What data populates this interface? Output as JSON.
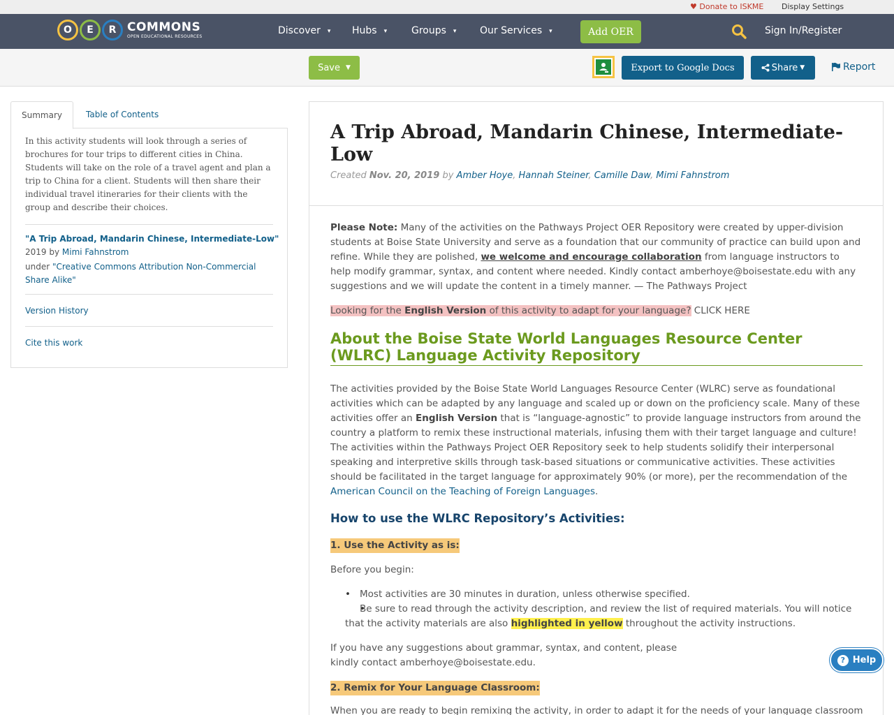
{
  "utility_bar": {
    "donate_label": "Donate to ISKME",
    "display_settings_label": "Display Settings"
  },
  "logo": {
    "letters": [
      "O",
      "E",
      "R"
    ],
    "main": "COMMONS",
    "sub": "OPEN EDUCATIONAL RESOURCES"
  },
  "nav": {
    "items": [
      {
        "label": "Discover"
      },
      {
        "label": "Hubs"
      },
      {
        "label": "Groups"
      },
      {
        "label": "Our Services"
      }
    ],
    "add_oer_label": "Add OER",
    "signin_label": "Sign In/Register"
  },
  "actions": {
    "save_label": "Save",
    "export_label": "Export to Google Docs",
    "share_label": "Share",
    "report_label": "Report"
  },
  "sidebar": {
    "tabs": [
      {
        "label": "Summary",
        "active": true
      },
      {
        "label": "Table of Contents",
        "active": false
      }
    ],
    "summary": "In this activity students will look through a series of brochures for tour trips to different cities in China. Students will take on the role of a travel agent and plan a trip to China for a client. Students will then share their individual travel itineraries for their clients with the group and describe their choices.",
    "license_title": "\"A Trip Abroad, Mandarin Chinese, Intermediate-Low\"",
    "license_year_by": "2019 by",
    "license_author": "Mimi Fahnstrom",
    "license_under": "under",
    "license_name": "\"Creative Commons Attribution Non-Commercial Share Alike\"",
    "version_history_label": "Version History",
    "cite_label": "Cite this work"
  },
  "resource": {
    "title": "A Trip Abroad, Mandarin Chinese, Intermediate-Low",
    "created_prefix": "Created",
    "created_date": "Nov. 20, 2019",
    "by": "by",
    "authors": [
      "Amber Hoye",
      "Hannah Steiner",
      "Camille Daw",
      "Mimi Fahnstrom"
    ],
    "note_label": "Please Note:",
    "note_text_1": "Many of the activities on the Pathways Project OER Repository were created by upper-division students at Boise State University and serve as a foundation that our community of practice can build upon and refine. While they are polished,",
    "note_collab": "we welcome and encourage collaboration",
    "note_text_2": "from language instructors to help modify grammar, syntax, and content where needed. Kindly contact amberhoye@boisestate.edu with any suggestions and we will update the content in a timely manner.  — The Pathways Project",
    "english_pre": "Looking for the",
    "english_bold": "English Version",
    "english_post": "of this activity to adapt for your language?",
    "click_here": "CLICK HERE",
    "about_heading": "About the Boise State World Languages Resource Center (WLRC) Language Activity Repository",
    "about_p1": "The activities provided by the Boise State World Languages Resource Center (WLRC) serve as foundational activities which can be adapted by any language and scaled up or down on the proficiency scale. Many of these activities offer an",
    "about_bold": "English Version",
    "about_p2": "that is “language-agnostic” to provide language instructors from around the country a platform to remix these instructional materials, infusing them with their target language and culture! The activities within the Pathways Project OER Repository seek to help students solidify their interpersonal speaking and interpretive skills through task-based situations or communicative activities. These activities should be facilitated in the target language for approximately 90% (or more), per the recommendation of the",
    "actfl_link": "American Council on the Teaching of Foreign Languages",
    "how_heading": "How to use the WLRC Repository’s Activities:",
    "step1": "1. Use the Activity as is:",
    "before_begin": "Before you begin:",
    "bullet1": "Most activities are 30 minutes in duration, unless otherwise specified.",
    "bullet2_pre": "Be sure to read through the activity description, and review the list of required materials. You will notice that the activity materials are also",
    "bullet2_hl": "highlighted in yellow",
    "bullet2_post": "throughout the activity instructions.",
    "suggestions": "If you have any suggestions about grammar, syntax, and content, please kindly contact amberhoye@boisestate.edu.",
    "step2": "2. Remix for Your Language Classroom:",
    "remix_text": "When you are ready to begin remixing the activity, in order to adapt it for the needs of your language classroom"
  },
  "help_label": "Help",
  "colors": {
    "nav_bg": "#4a5366",
    "green": "#8dbd46",
    "blue": "#12608a",
    "heading_green": "#6b9a1e"
  }
}
